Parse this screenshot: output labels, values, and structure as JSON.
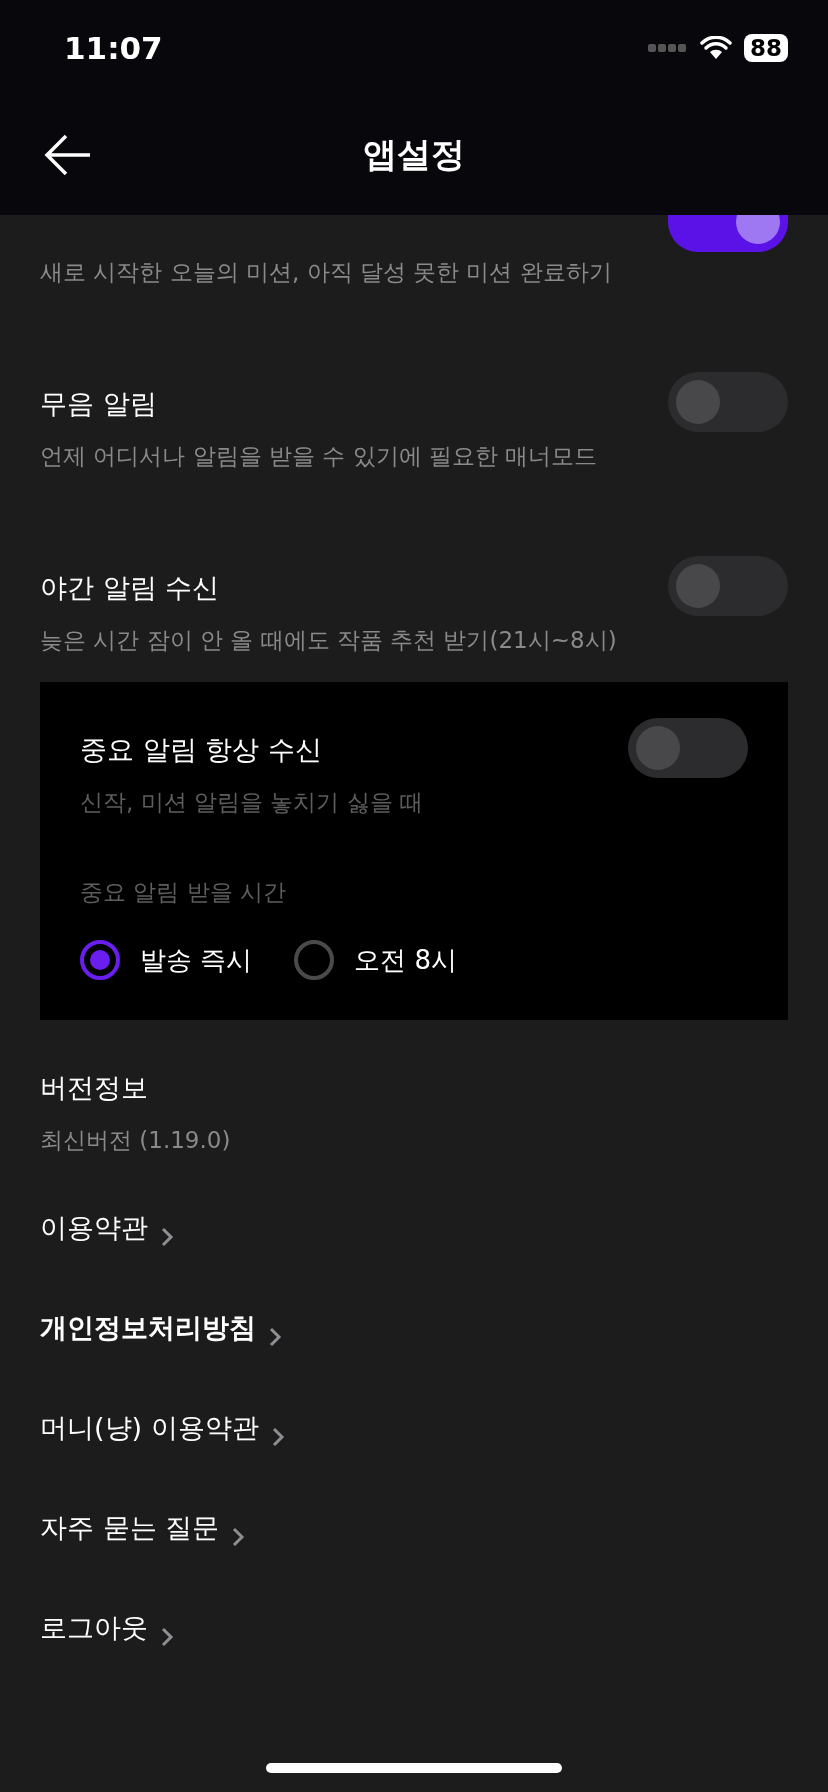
{
  "status_bar": {
    "time": "11:07",
    "battery": "88"
  },
  "header": {
    "title": "앱설정"
  },
  "toggle_settings": [
    {
      "subtitle": "새로 시작한 오늘의 미션, 아직 달성 못한 미션 완료하기",
      "on": true
    },
    {
      "title": "무음 알림",
      "subtitle": "언제 어디서나 알림을 받을 수 있기에 필요한 매너모드",
      "on": false
    },
    {
      "title": "야간 알림 수신",
      "subtitle": "늦은 시간 잠이 안 올 때에도 작품 추천 받기(21시~8시)",
      "on": false
    }
  ],
  "important_panel": {
    "title": "중요 알림 항상 수신",
    "subtitle": "신작, 미션 알림을 놓치기 싫을 때",
    "on": false,
    "time_label": "중요 알림 받을 시간",
    "options": [
      {
        "label": "발송 즉시",
        "selected": true
      },
      {
        "label": "오전 8시",
        "selected": false
      }
    ]
  },
  "version": {
    "title": "버전정보",
    "value": "최신버전 (1.19.0)"
  },
  "links": [
    {
      "label": "이용약관",
      "bold": false
    },
    {
      "label": "개인정보처리방침",
      "bold": true
    },
    {
      "label": "머니(냥) 이용약관",
      "bold": false
    },
    {
      "label": "자주 묻는 질문",
      "bold": false
    },
    {
      "label": "로그아웃",
      "bold": false
    }
  ]
}
